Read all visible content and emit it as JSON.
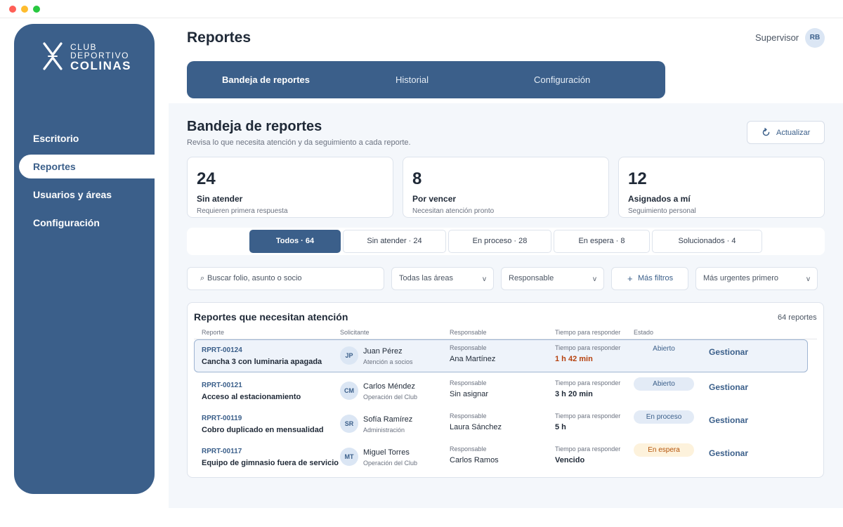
{
  "brand": {
    "line1": "CLUB",
    "line2": "DEPORTIVO",
    "line3": "COLINAS"
  },
  "sidebar": {
    "items": [
      {
        "label": "Escritorio"
      },
      {
        "label": "Reportes"
      },
      {
        "label": "Usuarios y áreas"
      },
      {
        "label": "Configuración"
      }
    ]
  },
  "header": {
    "title": "Reportes",
    "role": "Supervisor",
    "initials": "RB"
  },
  "tabs": [
    {
      "label": "Bandeja de reportes"
    },
    {
      "label": "Historial"
    },
    {
      "label": "Configuración"
    }
  ],
  "section": {
    "title": "Bandeja de reportes",
    "subtitle": "Revisa lo que necesita atención y da seguimiento a cada reporte.",
    "refresh_label": "Actualizar"
  },
  "stats": [
    {
      "value": "24",
      "label": "Sin atender",
      "sub": "Requieren primera respuesta"
    },
    {
      "value": "8",
      "label": "Por vencer",
      "sub": "Necesitan atención pronto"
    },
    {
      "value": "12",
      "label": "Asignados a mí",
      "sub": "Seguimiento personal"
    }
  ],
  "filters": [
    {
      "label": "Todos · 64"
    },
    {
      "label": "Sin atender · 24"
    },
    {
      "label": "En proceso · 28"
    },
    {
      "label": "En espera · 8"
    },
    {
      "label": "Solucionados · 4"
    }
  ],
  "toolbar": {
    "search_placeholder": "Buscar folio, asunto o socio",
    "area": "Todas las áreas",
    "responsable": "Responsable",
    "more_filters": "Más filtros",
    "sort": "Más urgentes primero"
  },
  "table": {
    "title": "Reportes que necesitan atención",
    "count": "64 reportes",
    "headers": {
      "report": "Reporte",
      "requester": "Solicitante",
      "owner": "Responsable",
      "time": "Tiempo para responder",
      "status": "Estado"
    },
    "owner_label": "Responsable",
    "time_label": "Tiempo para responder",
    "action_label": "Gestionar",
    "rows": [
      {
        "id": "RPRT-00124",
        "subject": "Cancha 3 con luminaria apagada",
        "initials": "JP",
        "name": "Juan Pérez",
        "area": "Atención a socios",
        "owner": "Ana Martínez",
        "time": "1 h 42 min",
        "status": "Abierto"
      },
      {
        "id": "RPRT-00121",
        "subject": "Acceso al estacionamiento",
        "initials": "CM",
        "name": "Carlos Méndez",
        "area": "Operación del Club",
        "owner": "Sin asignar",
        "time": "3 h 20 min",
        "status": "Abierto"
      },
      {
        "id": "RPRT-00119",
        "subject": "Cobro duplicado en mensualidad",
        "initials": "SR",
        "name": "Sofía Ramírez",
        "area": "Administración",
        "owner": "Laura Sánchez",
        "time": "5 h",
        "status": "En proceso"
      },
      {
        "id": "RPRT-00117",
        "subject": "Equipo de gimnasio fuera de servicio",
        "initials": "MT",
        "name": "Miguel Torres",
        "area": "Operación del Club",
        "owner": "Carlos Ramos",
        "time": "Vencido",
        "status": "En espera"
      }
    ]
  },
  "colors": {
    "primary": "#3b5f8a",
    "background": "#f4f7fb",
    "urgent": "#b6420f",
    "waiting_bg": "#fdf2dc"
  }
}
